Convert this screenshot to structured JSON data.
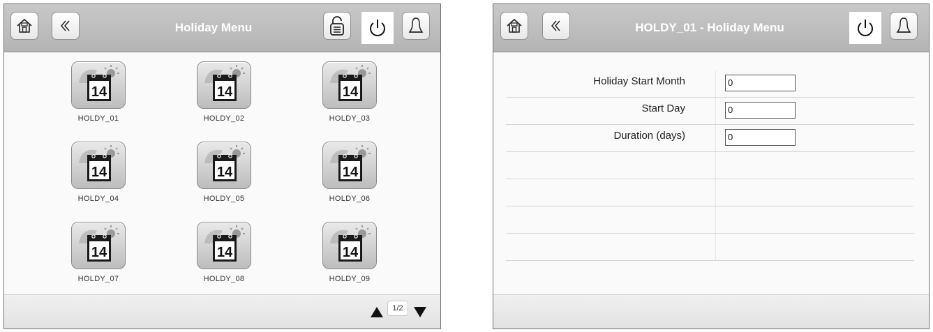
{
  "left_panel": {
    "title": "Holiday Menu",
    "toolbar": {
      "home_icon": "house-icon",
      "back_icon": "double-chevron-left-icon",
      "login_icon": "padlock-list-icon",
      "power_icon": "power-icon",
      "alarm_icon": "bell-icon"
    },
    "items": [
      {
        "label": "HOLDY_01",
        "day": "14"
      },
      {
        "label": "HOLDY_02",
        "day": "14"
      },
      {
        "label": "HOLDY_03",
        "day": "14"
      },
      {
        "label": "HOLDY_04",
        "day": "14"
      },
      {
        "label": "HOLDY_05",
        "day": "14"
      },
      {
        "label": "HOLDY_06",
        "day": "14"
      },
      {
        "label": "HOLDY_07",
        "day": "14"
      },
      {
        "label": "HOLDY_08",
        "day": "14"
      },
      {
        "label": "HOLDY_09",
        "day": "14"
      }
    ],
    "pager": {
      "page": "1/2"
    }
  },
  "right_panel": {
    "title": "HOLDY_01 - Holiday Menu",
    "fields": [
      {
        "label": "Holiday Start Month",
        "value": "0"
      },
      {
        "label": "Start Day",
        "value": "0"
      },
      {
        "label": "Duration (days)",
        "value": "0"
      }
    ]
  },
  "colors": {
    "header": "#b8b8b8",
    "title_text": "#ffffff",
    "tile": "#cfcfcf"
  }
}
